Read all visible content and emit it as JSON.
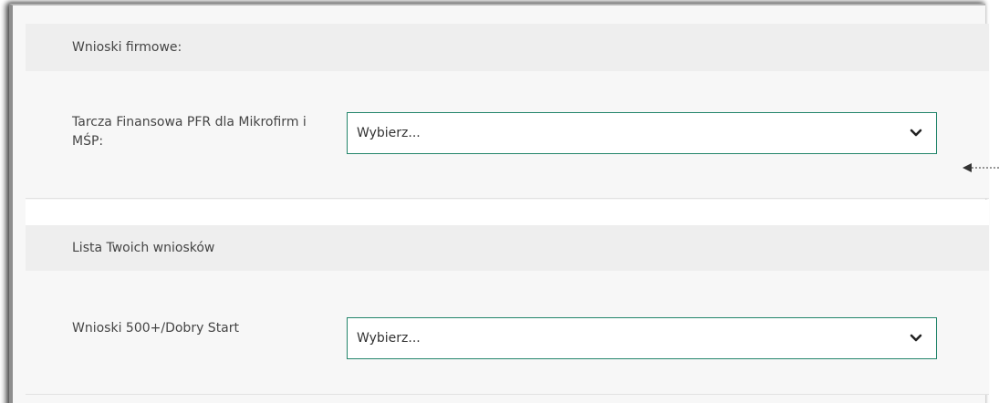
{
  "sections": [
    {
      "header": "Wnioski firmowe:",
      "field_label": "Tarcza Finansowa PFR dla Mikrofirm i MŚP:",
      "select_value": "Wybierz..."
    },
    {
      "header": "Lista Twoich wniosków",
      "field_label": "Wnioski 500+/Dobry Start",
      "select_value": "Wybierz..."
    }
  ],
  "colors": {
    "select_border": "#23856b",
    "header_bg": "#eeeeee",
    "body_bg": "#f7f7f7",
    "text": "#454545"
  },
  "icons": {
    "select_chevron": "chevron-down-icon",
    "annotation": "arrow-left-icon"
  }
}
